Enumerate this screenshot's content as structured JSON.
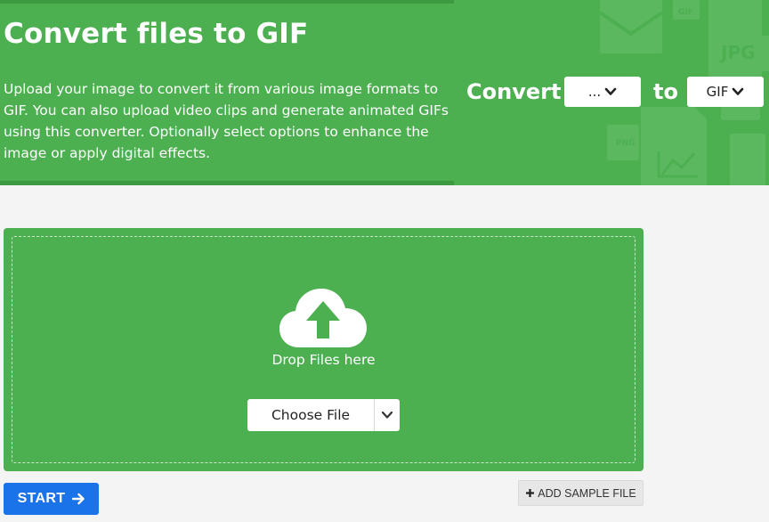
{
  "hero": {
    "title": "Convert files to GIF",
    "description": "Upload your image to convert it from various image formats to GIF. You can also upload video clips and generate animated GIFs using this converter. Optionally select options to enhance the image or apply digital effects.",
    "convert_label": "Convert",
    "to_label": "to",
    "from_format": "...",
    "to_format": "GIF",
    "deco_labels": [
      "JPG",
      "PNG",
      "GIF"
    ]
  },
  "upload": {
    "drop_text": "Drop Files here",
    "choose_label": "Choose File"
  },
  "actions": {
    "start_label": "START",
    "sample_label": "ADD SAMPLE FILE"
  },
  "colors": {
    "brand_green": "#4caf50",
    "dark_green": "#3d9a41",
    "start_blue": "#1a73e8",
    "page_bg": "#f4f4f4"
  }
}
